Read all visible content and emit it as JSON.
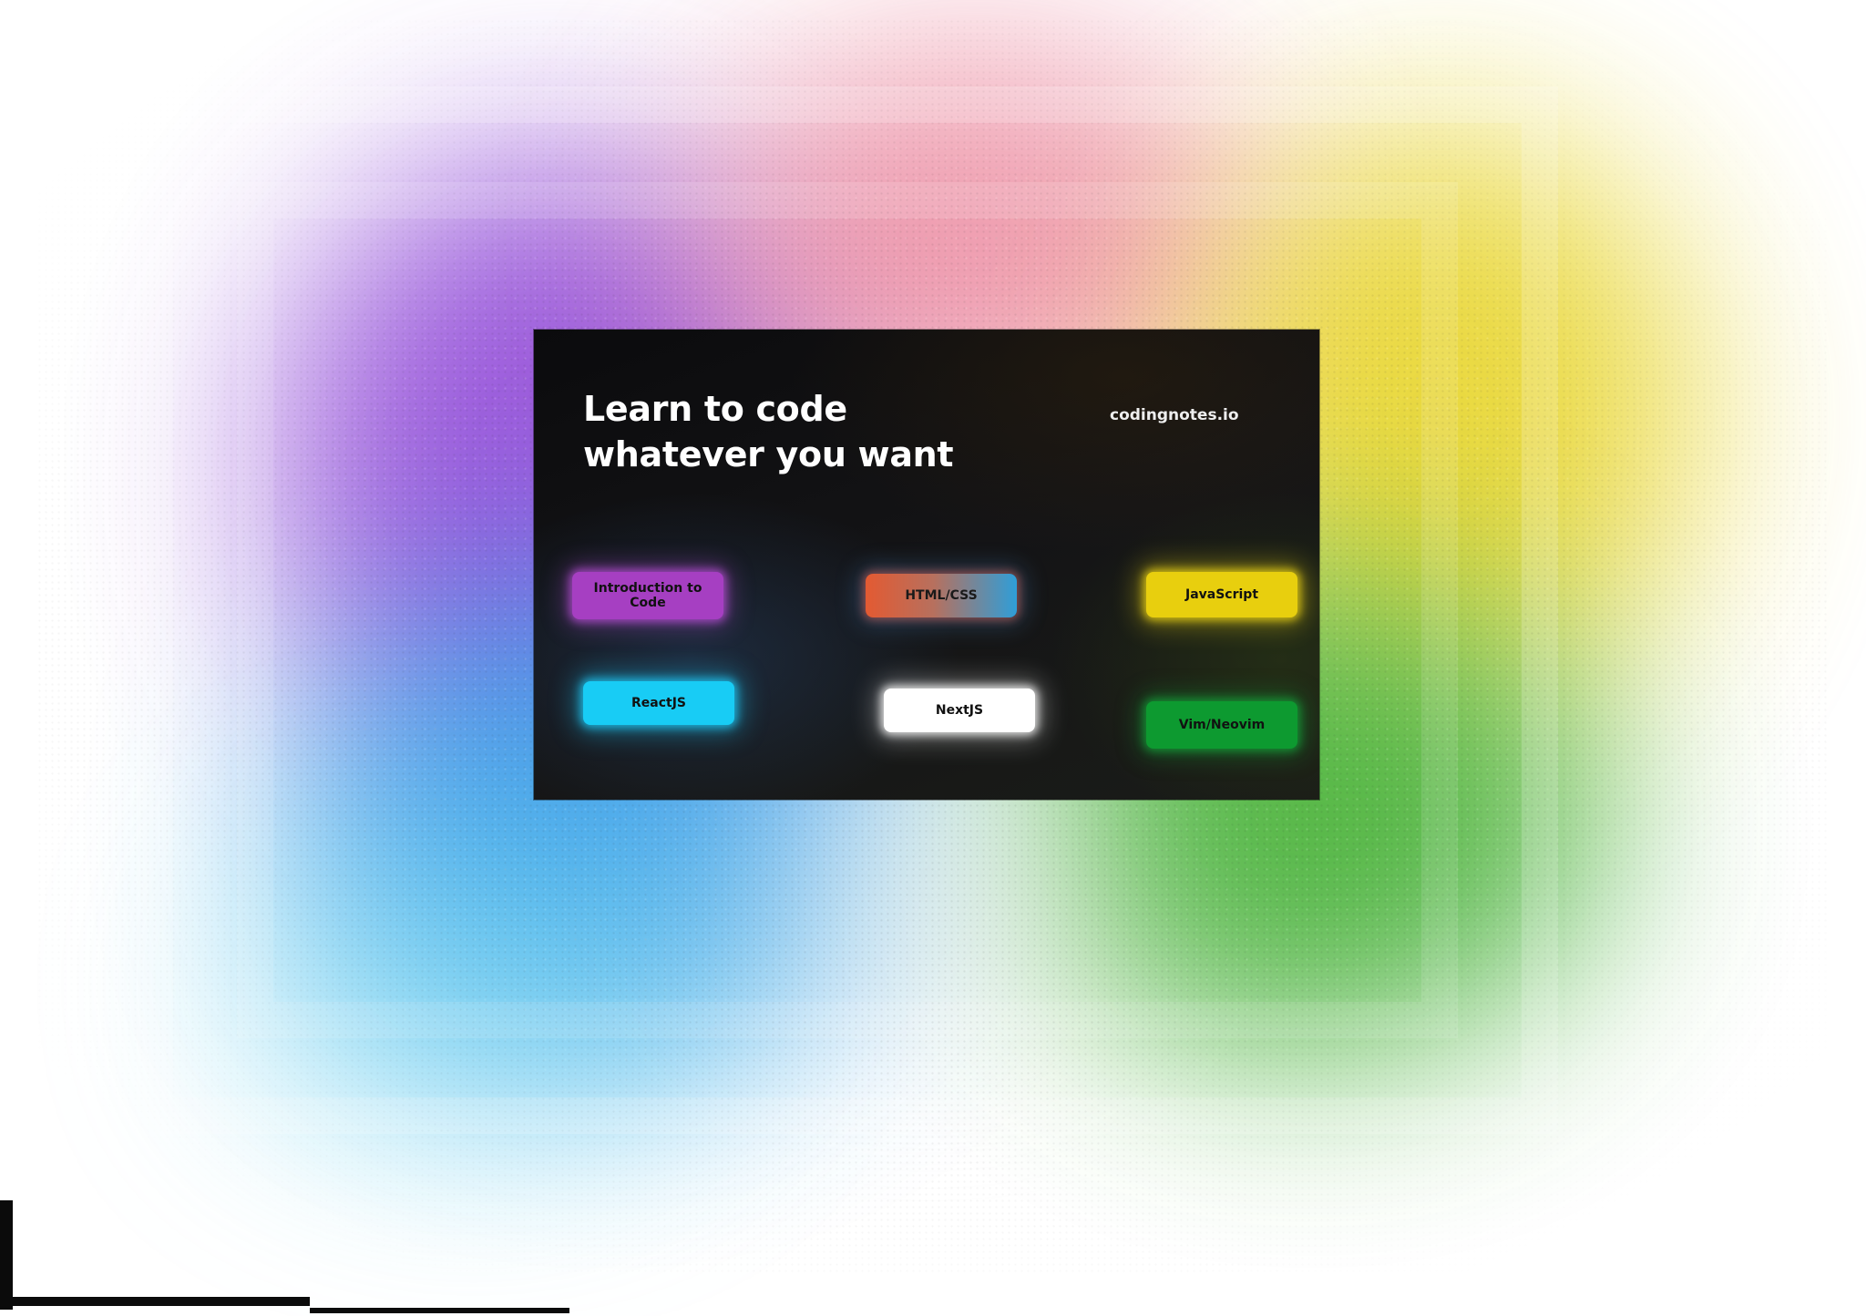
{
  "hero": {
    "title_line1": "Learn to code",
    "title_line2": "whatever you want",
    "site": "codingnotes.io"
  },
  "courses": [
    {
      "label": "Introduction to Code",
      "color": "#a63fc2"
    },
    {
      "label": "HTML/CSS",
      "color": "#e35a32"
    },
    {
      "label": "JavaScript",
      "color": "#e8cf0e"
    },
    {
      "label": "ReactJS",
      "color": "#18ccf5"
    },
    {
      "label": "NextJS",
      "color": "#ffffff"
    },
    {
      "label": "Vim/Neovim",
      "color": "#0d9a30"
    }
  ],
  "colors": {
    "card_background": "#111113",
    "title_text": "#ffffff"
  }
}
